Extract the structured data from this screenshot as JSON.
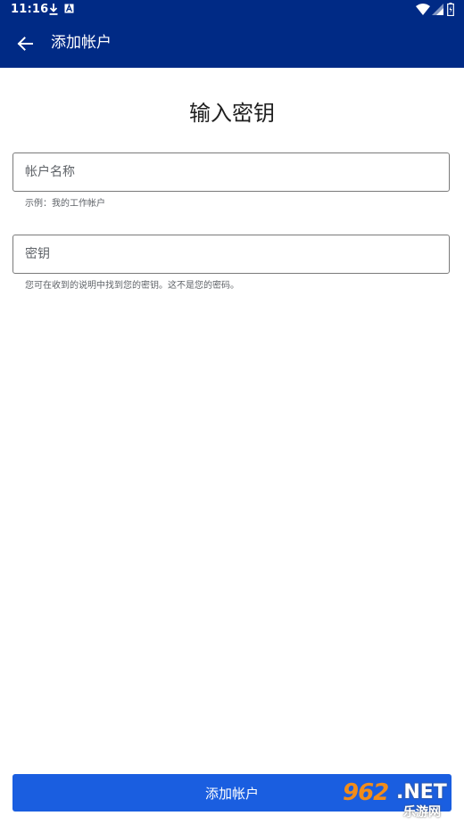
{
  "status_bar": {
    "time": "11:16",
    "icons": [
      "download-icon",
      "a-icon",
      "wifi-icon",
      "signal-icon",
      "battery-icon"
    ]
  },
  "app_bar": {
    "back_icon": "arrow-left-icon",
    "title": "添加帐户"
  },
  "page": {
    "heading": "输入密钥"
  },
  "form": {
    "account_name": {
      "placeholder": "帐户名称",
      "value": "",
      "helper": "示例：我的工作帐户"
    },
    "key": {
      "placeholder": "密钥",
      "value": "",
      "helper": "您可在收到的说明中找到您的密钥。这不是您的密码。"
    },
    "submit_label": "添加帐户"
  },
  "watermark": {
    "number": "962",
    "suffix": ".NET",
    "subtitle": "乐游网"
  },
  "colors": {
    "header_bg": "#002a85",
    "button_bg": "#1a5ee0",
    "field_border": "#7a7a7a",
    "helper_text": "#5f6368"
  }
}
